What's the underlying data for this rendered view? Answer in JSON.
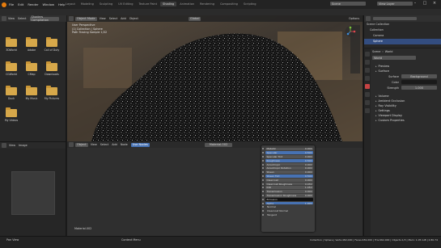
{
  "app": {
    "title": "Blender",
    "menu": [
      "File",
      "Edit",
      "Render",
      "Window",
      "Help"
    ],
    "tabs": [
      "Layout",
      "Modeling",
      "Sculpting",
      "UV Editing",
      "Texture Paint",
      "Shading",
      "Animation",
      "Rendering",
      "Compositing",
      "Scripting"
    ],
    "active_tab": "Shading",
    "scene_label": "Scene",
    "view_layer_label": "View Layer"
  },
  "file_browser": {
    "header": [
      "View",
      "Select"
    ],
    "path_label": "Shaders Compilation",
    "folders": [
      "3DWorld",
      "Adobe",
      "Call of Duty",
      "CGWorld",
      "CMap",
      "Downloads",
      "Duck",
      "My Music",
      "My Pictures",
      "My Videos"
    ]
  },
  "viewport": {
    "header": [
      "Object Mode",
      "View",
      "Select",
      "Add",
      "Object"
    ],
    "overlay_lines": [
      "User Perspective",
      "(1) Collection | Sphere",
      "Path Tracing Sample 1/32"
    ],
    "shading_label": "Global",
    "options_label": "Options"
  },
  "outliner": {
    "items": [
      "Scene Collection",
      "Collection",
      "Camera",
      "Sphere"
    ]
  },
  "properties": {
    "header_left": "Scene",
    "header_right": "World",
    "world_name": "World",
    "sections": [
      "Preview",
      "Surface"
    ],
    "surface_label": "Surface",
    "surface_value": "Background",
    "color_label": "Color",
    "strength_label": "Strength",
    "strength_value": "1.000",
    "sections2": [
      "Volume",
      "Ambient Occlusion",
      "Ray Visibility",
      "Settings",
      "Viewport Display",
      "Custom Properties"
    ]
  },
  "node_editor": {
    "header": [
      "Object",
      "View",
      "Select",
      "Add",
      "Node",
      "Use Nodes"
    ],
    "material_label": "Material.002",
    "footer_label": "Material.002",
    "bsdf_rows": [
      {
        "label": "Metallic",
        "value": "0.000",
        "style": "grey"
      },
      {
        "label": "Specular",
        "value": "0.500",
        "style": "blue"
      },
      {
        "label": "Specular Tint",
        "value": "0.000",
        "style": "grey"
      },
      {
        "label": "Roughness",
        "value": "0.500",
        "style": "blue"
      },
      {
        "label": "Anisotropic",
        "value": "0.000",
        "style": "grey"
      },
      {
        "label": "Anisotropic Rotation",
        "value": "0.000",
        "style": "grey"
      },
      {
        "label": "Sheen",
        "value": "0.000",
        "style": "grey"
      },
      {
        "label": "Sheen Tint",
        "value": "0.500",
        "style": "blue"
      },
      {
        "label": "Clearcoat",
        "value": "0.000",
        "style": "grey"
      },
      {
        "label": "Clearcoat Roughness",
        "value": "0.030",
        "style": "grey"
      },
      {
        "label": "IOR",
        "value": "1.450",
        "style": "grey"
      },
      {
        "label": "Transmission",
        "value": "0.000",
        "style": "grey"
      },
      {
        "label": "Transmission Roughness",
        "value": "0.000",
        "style": "grey"
      },
      {
        "label": "Emission",
        "value": "",
        "style": "black"
      },
      {
        "label": "Alpha",
        "value": "1.000",
        "style": "blue"
      },
      {
        "label": "Normal",
        "value": "",
        "style": "plain"
      },
      {
        "label": "Clearcoat Normal",
        "value": "",
        "style": "plain"
      },
      {
        "label": "Tangent",
        "value": "",
        "style": "plain"
      }
    ]
  },
  "image_panel": {
    "header": [
      "View",
      "Image"
    ]
  },
  "status": {
    "left": "Pan View",
    "middle": "Context Menu",
    "right": "Collection | Sphere | Verts:482,000 | Faces:481,000 | Tris:962,000 | Objects:1/3 | Mem: 1.05 GiB | 2.80.74"
  },
  "colors": {
    "accent": "#4772b3",
    "blender_orange": "#e87d0d",
    "folder": "#d7a84a"
  }
}
